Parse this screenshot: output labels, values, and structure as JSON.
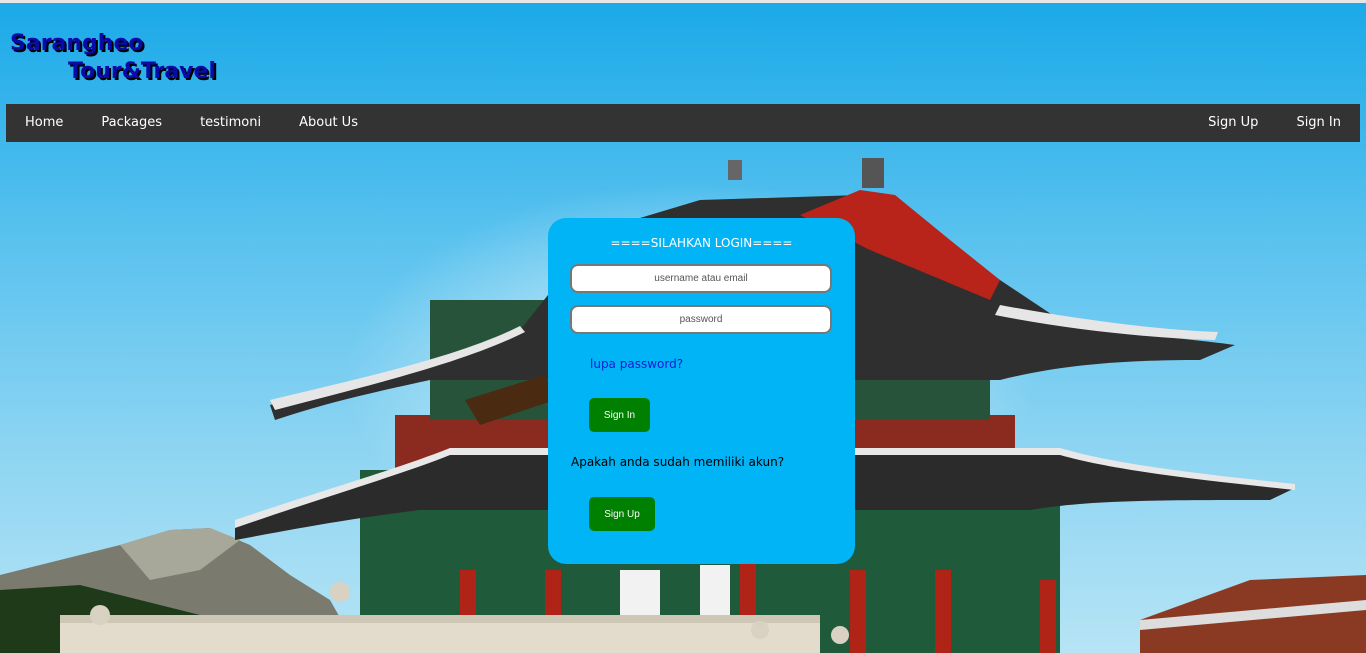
{
  "brand": {
    "line1": "Sarangheo",
    "line2": "Tour&Travel"
  },
  "nav": {
    "left": [
      "Home",
      "Packages",
      "testimoni",
      "About Us"
    ],
    "right": [
      "Sign Up",
      "Sign In"
    ]
  },
  "login": {
    "title": "====SILAHKAN LOGIN====",
    "username_placeholder": "username atau email",
    "password_placeholder": "password",
    "forgot_label": "lupa password?",
    "signin_label": "Sign In",
    "question": "Apakah anda sudah memiliki akun?",
    "signup_label": "Sign Up"
  },
  "colors": {
    "navbar": "#333333",
    "login_panel": "#00b4f5",
    "button": "#008000",
    "link": "#1a1ad8",
    "brand": "#0a0aa8"
  }
}
